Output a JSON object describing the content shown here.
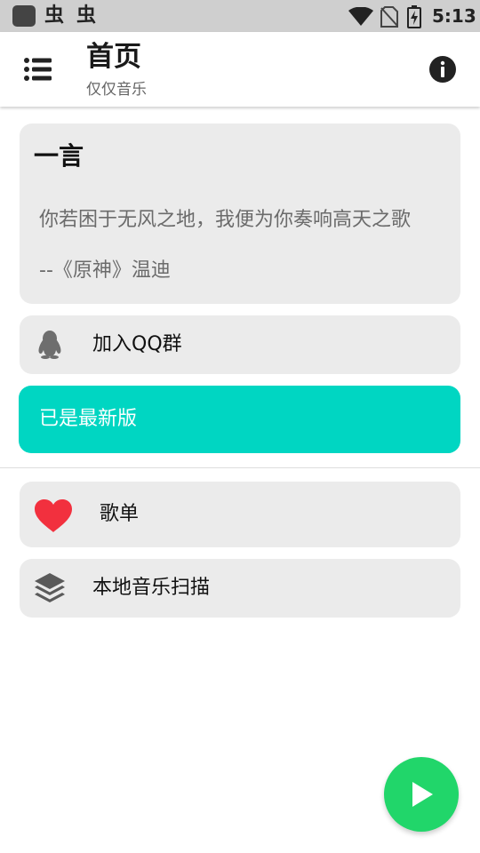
{
  "status_bar": {
    "time": "5:13",
    "app_icon": "app-square-icon",
    "notification_icons": [
      "bug-icon",
      "bug-icon"
    ],
    "notification_glyph": "虫",
    "right_icons": [
      "wifi-icon",
      "no-sim-icon",
      "battery-charging-icon"
    ]
  },
  "appbar": {
    "title": "首页",
    "subtitle": "仅仅音乐",
    "menu_icon": "list-menu-icon",
    "info_icon": "info-icon"
  },
  "quote_card": {
    "heading": "一言",
    "text": "你若困于无风之地，我便为你奏响高天之歌",
    "source": "--《原神》温迪"
  },
  "qq_group": {
    "label": "加入QQ群",
    "icon": "qq-penguin-icon"
  },
  "version": {
    "label": "已是最新版"
  },
  "playlist": {
    "label": "歌单",
    "icon": "heart-icon"
  },
  "local_scan": {
    "label": "本地音乐扫描",
    "icon": "layers-icon"
  },
  "fab": {
    "icon": "play-icon"
  },
  "colors": {
    "accent_teal": "#00d6c2",
    "fab_green": "#21d66a",
    "heart_red": "#f2303e",
    "card_bg": "#ebebeb",
    "status_bar_bg": "#cfcfcf"
  }
}
